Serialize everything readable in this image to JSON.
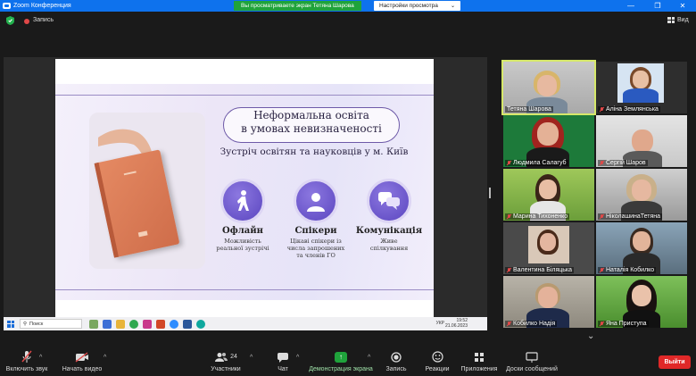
{
  "window": {
    "app_title": "Zoom Конференция",
    "share_banner": "Вы просматриваете экран Тетяна Шарова",
    "view_options": "Настройки просмотра",
    "minimize": "—",
    "maximize": "❐",
    "close": "✕"
  },
  "topbar": {
    "record_label": "Запись",
    "view_label": "Вид"
  },
  "slide": {
    "title_line1": "Неформальна освіта",
    "title_line2": "в умовах невизначеності",
    "subtitle": "Зустріч освітян та науковців у м. Київ",
    "features": [
      {
        "title": "Офлайн",
        "desc_line1": "Можливість",
        "desc_line2": "реальної зустрічі",
        "desc_line3": ""
      },
      {
        "title": "Спікери",
        "desc_line1": "Цікаві спікери із",
        "desc_line2": "числа запрошених",
        "desc_line3": "та членів ГО"
      },
      {
        "title": "Комунікація",
        "desc_line1": "Живе",
        "desc_line2": "спілкування",
        "desc_line3": ""
      }
    ]
  },
  "remote_taskbar": {
    "search_placeholder": "Поиск",
    "language": "УКР",
    "time": "19:52",
    "date": "21.06.2023"
  },
  "participants": [
    {
      "name": "Тетяна Шарова",
      "muted": false,
      "active": true
    },
    {
      "name": "Аліна Землянська",
      "muted": true,
      "active": false
    },
    {
      "name": "Людмила Салагуб",
      "muted": true,
      "active": false
    },
    {
      "name": "Сергій Шаров",
      "muted": true,
      "active": false
    },
    {
      "name": "Марина Тихоненко",
      "muted": true,
      "active": false
    },
    {
      "name": "НіколашинаТетяна",
      "muted": true,
      "active": false
    },
    {
      "name": "Валентина Біляцька",
      "muted": true,
      "active": false
    },
    {
      "name": "Наталія Кобилко",
      "muted": true,
      "active": false
    },
    {
      "name": "Кобилко Надія",
      "muted": true,
      "active": false
    },
    {
      "name": "Яна Приступа",
      "muted": true,
      "active": false
    }
  ],
  "toolbar": {
    "unmute_label": "Включить звук",
    "video_label": "Начать видео",
    "participants_label": "Участники",
    "participants_count": "24",
    "chat_label": "Чат",
    "share_label": "Демонстрация экрана",
    "record_label": "Запись",
    "reactions_label": "Реакции",
    "apps_label": "Приложения",
    "whiteboard_label": "Доски сообщений",
    "leave_label": "Выйти"
  },
  "colors": {
    "title_bar": "#0e72ed",
    "share_green": "#1fa33b",
    "leave_red": "#e02828",
    "active_speaker": "#d6e86a",
    "slide_accent": "#6e5aa8"
  }
}
